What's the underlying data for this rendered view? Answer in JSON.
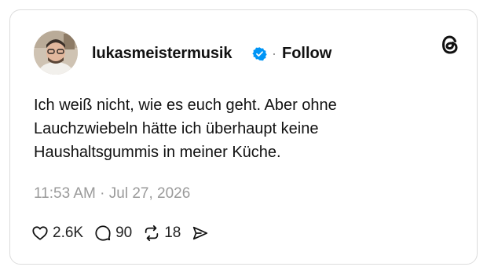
{
  "post": {
    "author": {
      "username": "lukasmeistermusik",
      "verified": true,
      "avatar_icon": "avatar-photo"
    },
    "separator": "·",
    "follow_label": "Follow",
    "platform_icon": "threads-logo-icon",
    "text_lines": [
      "Ich weiß nicht, wie es euch geht. Aber ohne",
      "Lauchzwiebeln hätte ich überhaupt keine",
      "Haushaltsgummis in meiner Küche."
    ],
    "timestamp": "11:53 AM · Jul 27, 2026",
    "actions": {
      "likes": "2.6K",
      "replies": "90",
      "reposts": "18"
    }
  },
  "colors": {
    "text": "#111111",
    "muted": "#9a9a9a",
    "verified_blue": "#0095f6",
    "border": "#dcdcdc"
  }
}
